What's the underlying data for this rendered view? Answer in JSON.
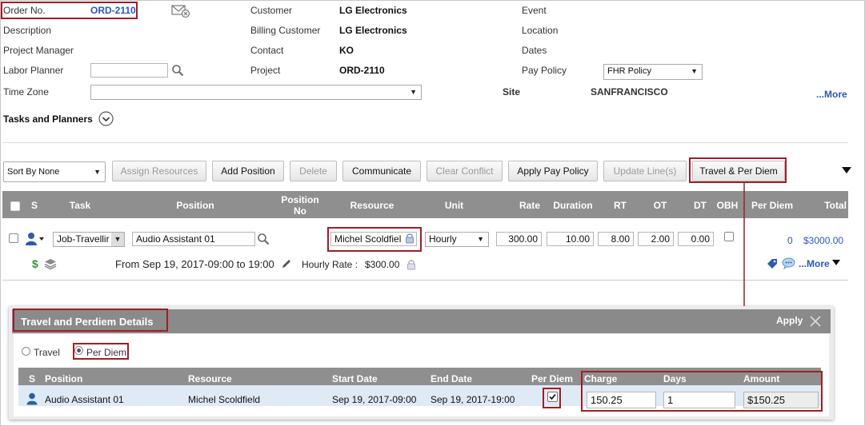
{
  "header": {
    "order_no_label": "Order No.",
    "order_no_value": "ORD-2110",
    "description_label": "Description",
    "project_manager_label": "Project Manager",
    "labor_planner_label": "Labor Planner",
    "time_zone_label": "Time Zone",
    "customer_label": "Customer",
    "customer_value": "LG Electronics",
    "billing_customer_label": "Billing Customer",
    "billing_customer_value": "LG Electronics",
    "contact_label": "Contact",
    "contact_value": "KO",
    "project_label": "Project",
    "project_value": "ORD-2110",
    "event_label": "Event",
    "location_label": "Location",
    "dates_label": "Dates",
    "pay_policy_label": "Pay Policy",
    "pay_policy_value": "FHR Policy",
    "site_label": "Site",
    "site_value": "SANFRANCISCO",
    "more_link": "...More"
  },
  "tasks_section": {
    "title": "Tasks and Planners"
  },
  "toolbar": {
    "sort_select": "Sort By None",
    "assign_resources": "Assign Resources",
    "add_position": "Add Position",
    "delete": "Delete",
    "communicate": "Communicate",
    "clear_conflict": "Clear Conflict",
    "apply_pay_policy": "Apply Pay Policy",
    "update_lines": "Update Line(s)",
    "travel_per_diem": "Travel & Per Diem"
  },
  "grid": {
    "columns": {
      "s": "S",
      "task": "Task",
      "position": "Position",
      "position_no_1": "Position",
      "position_no_2": "No",
      "resource": "Resource",
      "unit": "Unit",
      "rate": "Rate",
      "duration": "Duration",
      "rt": "RT",
      "ot": "OT",
      "dt": "DT",
      "obh": "OBH",
      "per_diem": "Per Diem",
      "total": "Total"
    },
    "row": {
      "task": "Job-Travellir",
      "position": "Audio Assistant  01",
      "resource": "Michel Scoldfiel",
      "unit": "Hourly",
      "rate": "300.00",
      "duration": "10.00",
      "rt": "8.00",
      "ot": "2.00",
      "dt": "0.00",
      "per_diem": "0",
      "total": "$3000.00",
      "schedule": "From Sep 19, 2017-09:00 to 19:00",
      "hourly_rate_label": "Hourly Rate :",
      "hourly_rate_value": "$300.00",
      "more_link": "...More"
    }
  },
  "travel_panel": {
    "title": "Travel and Perdiem Details",
    "apply": "Apply",
    "travel_option": "Travel",
    "per_diem_option": "Per Diem",
    "columns": {
      "s": "S",
      "position": "Position",
      "resource": "Resource",
      "start_date": "Start Date",
      "end_date": "End Date",
      "per_diem": "Per Diem",
      "charge": "Charge",
      "days": "Days",
      "amount": "Amount"
    },
    "row": {
      "position": "Audio Assistant 01",
      "resource": "Michel Scoldfield",
      "start_date": "Sep 19, 2017-09:00",
      "end_date": "Sep 19, 2017-19:00",
      "charge": "150.25",
      "days": "1",
      "amount": "$150.25"
    }
  },
  "colors": {
    "highlight_border": "#a01e24",
    "header_gray": "#8f8f8f",
    "link_blue": "#2b58b8",
    "selected_row": "#dfeaf7"
  }
}
